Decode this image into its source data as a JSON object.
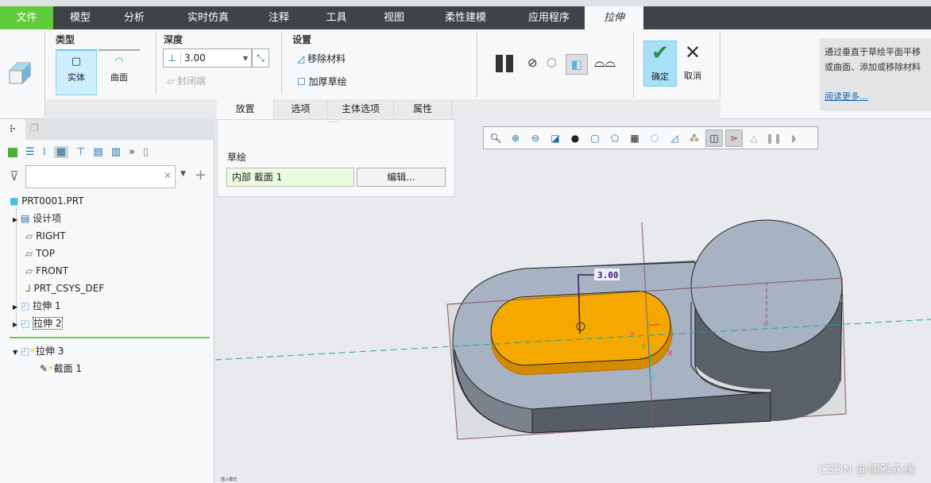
{
  "tabs": [
    {
      "label": "文件"
    },
    {
      "label": "模型"
    },
    {
      "label": "分析"
    },
    {
      "label": "实时仿真"
    },
    {
      "label": "注释"
    },
    {
      "label": "工具"
    },
    {
      "label": "视图"
    },
    {
      "label": "柔性建模"
    },
    {
      "label": "应用程序"
    },
    {
      "label": "拉伸"
    }
  ],
  "ribbon": {
    "type_group": {
      "title": "类型",
      "solid": "实体",
      "surface": "曲面"
    },
    "depth_group": {
      "title": "深度",
      "value": "3.00",
      "capped_ends": "封闭端"
    },
    "settings_group": {
      "title": "设置",
      "remove_material": "移除材料",
      "thicken_sketch": "加厚草绘"
    },
    "ok": "确定",
    "cancel": "取消",
    "subtabs": [
      "放置",
      "选项",
      "主体选项",
      "属性"
    ]
  },
  "help": {
    "line1": "通过垂直于草绘平面平移",
    "line2": "或曲面、添加或移除材料",
    "link": "阅读更多..."
  },
  "tree": {
    "search_placeholder": "",
    "items": [
      {
        "label": "PRT0001.PRT"
      },
      {
        "label": "设计项"
      },
      {
        "label": "RIGHT"
      },
      {
        "label": "TOP"
      },
      {
        "label": "FRONT"
      },
      {
        "label": "PRT_CSYS_DEF"
      },
      {
        "label": "拉伸 1"
      },
      {
        "label": "拉伸 2"
      },
      {
        "label": "拉伸 3"
      },
      {
        "label": "截面 1"
      }
    ]
  },
  "placement": {
    "title": "草绘",
    "sketch_value": "内部 截面 1",
    "edit_button": "编辑..."
  },
  "viewport": {
    "dimension": "3.00",
    "axis_x": "X",
    "axis_y": "Y",
    "axis_z": "Z",
    "status": "插入模式",
    "accent": "#f5a800"
  },
  "watermark": "CSDN @儒雅永缘"
}
